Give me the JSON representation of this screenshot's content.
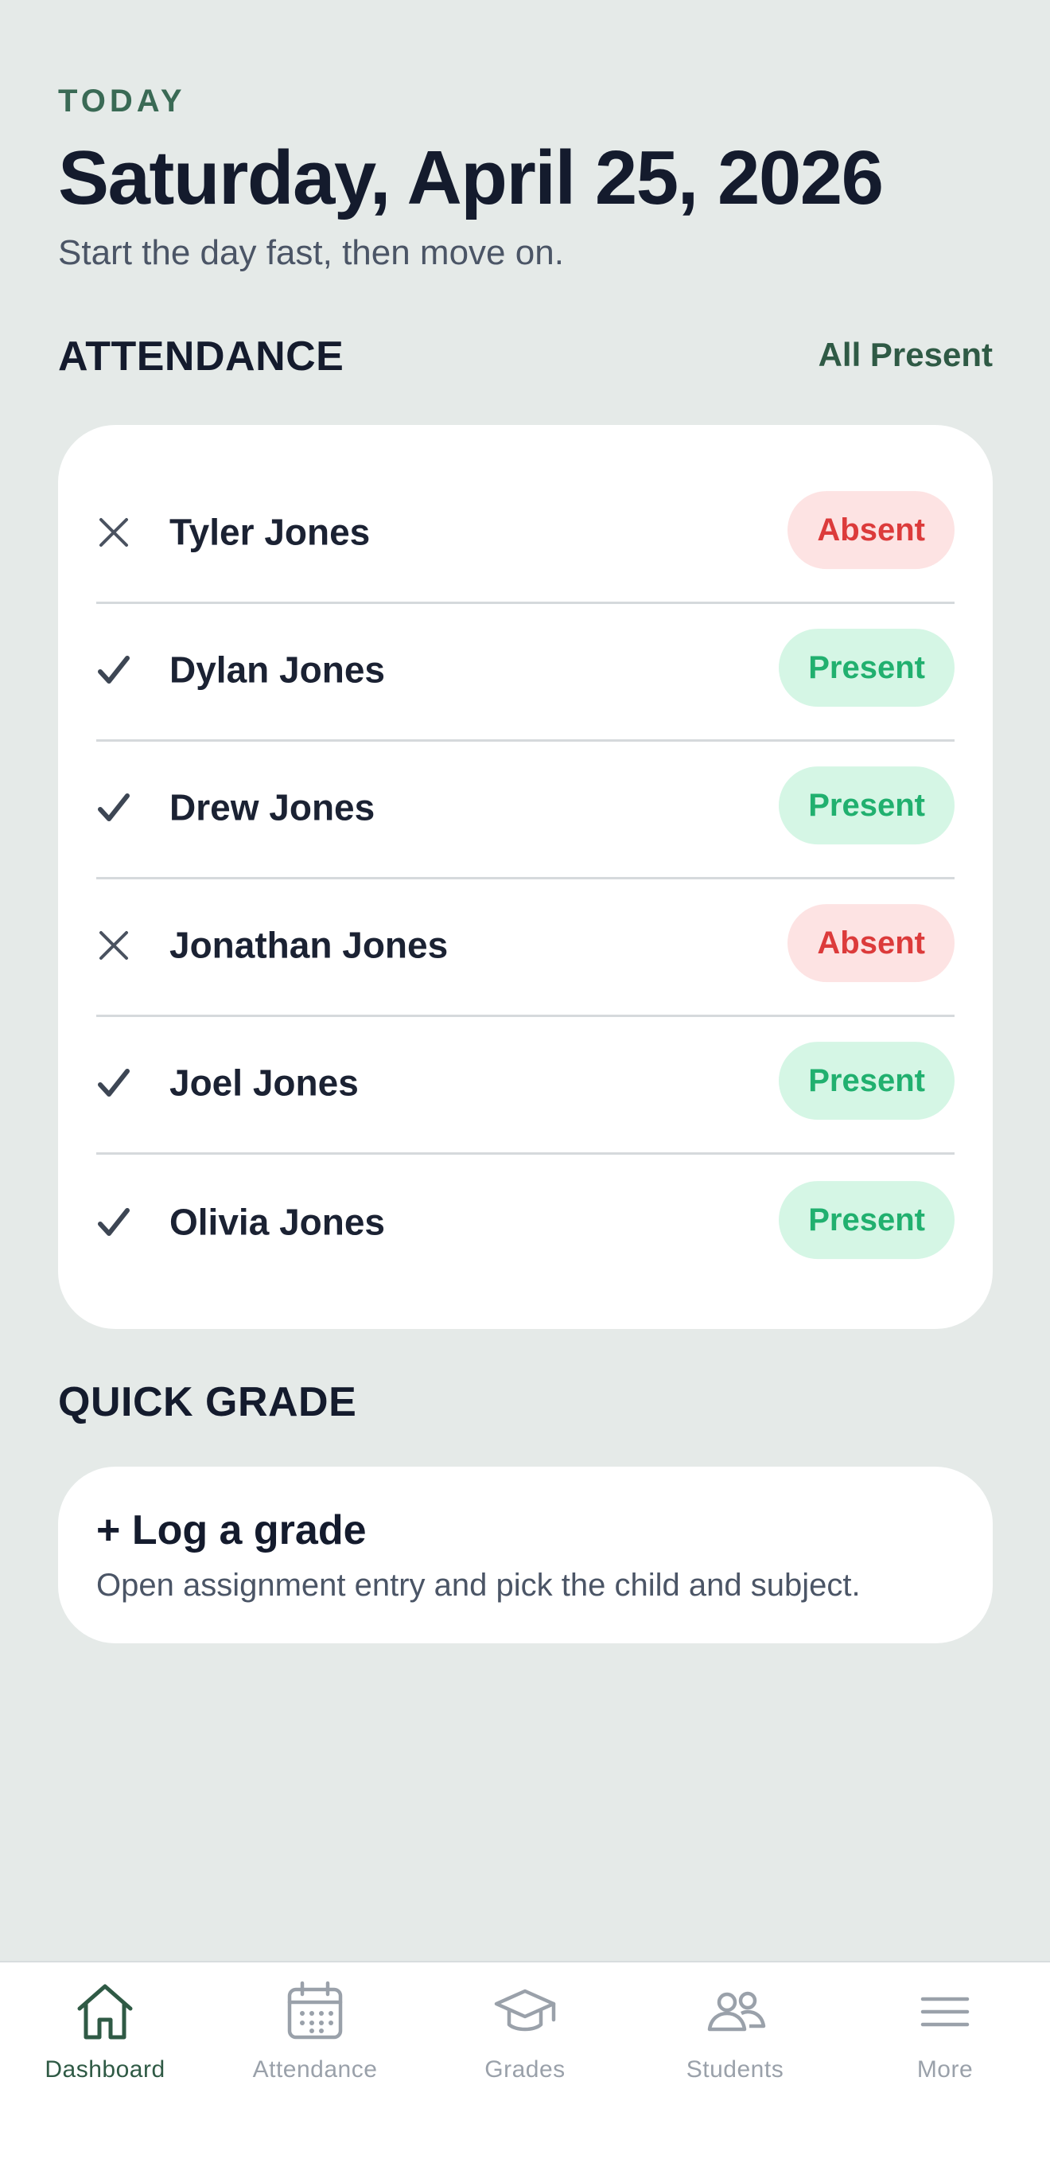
{
  "header": {
    "eyebrow": "TODAY",
    "date": "Saturday, April 25, 2026",
    "subtitle": "Start the day fast, then move on."
  },
  "attendance": {
    "title": "ATTENDANCE",
    "action_label": "All Present",
    "students": [
      {
        "name": "Tyler Jones",
        "status": "Absent",
        "icon": "x-icon"
      },
      {
        "name": "Dylan Jones",
        "status": "Present",
        "icon": "check-icon"
      },
      {
        "name": "Drew Jones",
        "status": "Present",
        "icon": "check-icon"
      },
      {
        "name": "Jonathan Jones",
        "status": "Absent",
        "icon": "x-icon"
      },
      {
        "name": "Joel Jones",
        "status": "Present",
        "icon": "check-icon"
      },
      {
        "name": "Olivia Jones",
        "status": "Present",
        "icon": "check-icon"
      }
    ]
  },
  "quick_grade": {
    "title": "QUICK GRADE",
    "card_title": "+ Log a grade",
    "card_description": "Open assignment entry and pick the child and subject."
  },
  "tabbar": {
    "active": "Dashboard",
    "tabs": [
      {
        "label": "Dashboard",
        "icon": "home-icon"
      },
      {
        "label": "Attendance",
        "icon": "calendar-icon"
      },
      {
        "label": "Grades",
        "icon": "graduation-cap-icon"
      },
      {
        "label": "Students",
        "icon": "users-icon"
      },
      {
        "label": "More",
        "icon": "menu-icon"
      }
    ]
  },
  "colors": {
    "background": "#e5eae8",
    "accent": "#2f5a45",
    "present_bg": "#d5f6e5",
    "present_text": "#21b06f",
    "absent_bg": "#fde3e3",
    "absent_text": "#dc3b3b"
  }
}
